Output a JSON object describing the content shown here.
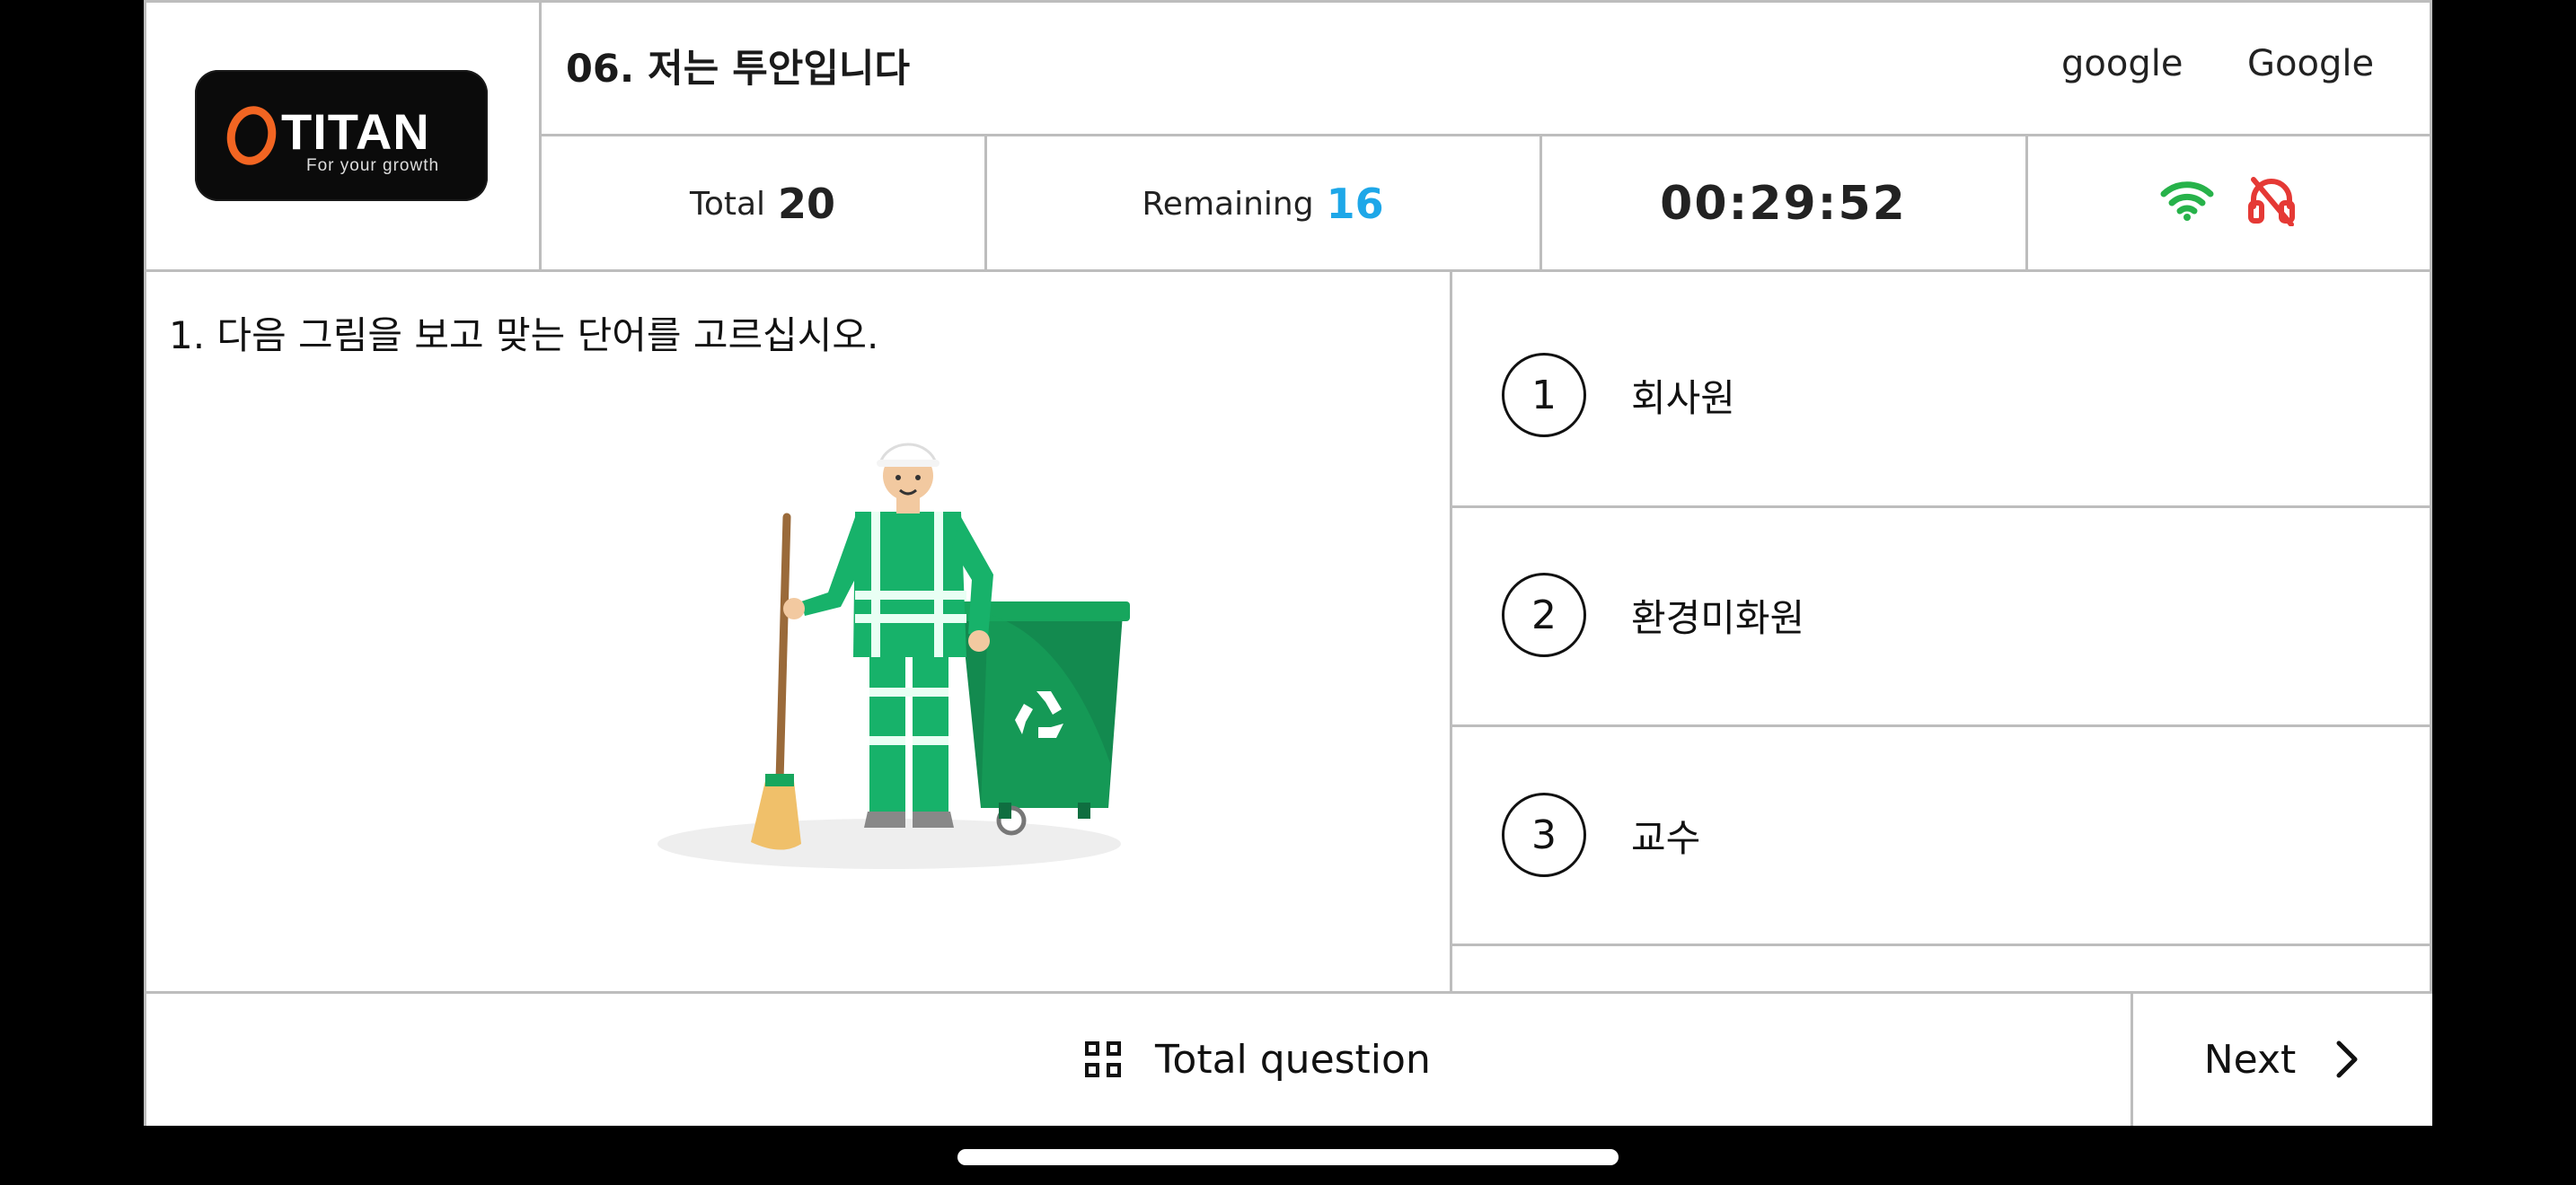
{
  "header": {
    "logo_text": "TITAN",
    "logo_tagline": "For your growth",
    "title": "06. 저는 투안입니다",
    "user_name_1": "google",
    "user_name_2": "Google"
  },
  "stats": {
    "total_label": "Total",
    "total_value": "20",
    "remaining_label": "Remaining",
    "remaining_value": "16",
    "timer": "00:29:52"
  },
  "status_icons": [
    "wifi-icon",
    "headphones-off-icon"
  ],
  "colors": {
    "remaining_value": "#1ea7e8",
    "wifi": "#27b24a",
    "headphones_off": "#e53935",
    "logo_accent": "#f26522",
    "worker_green": "#17b26a"
  },
  "question": {
    "text": "1. 다음 그림을 보고 맞는 단어를 고르십시오."
  },
  "answers": [
    {
      "number": "1",
      "text": "회사원"
    },
    {
      "number": "2",
      "text": "환경미화원"
    },
    {
      "number": "3",
      "text": "교수"
    }
  ],
  "footer": {
    "total_question_label": "Total question",
    "next_label": "Next"
  }
}
